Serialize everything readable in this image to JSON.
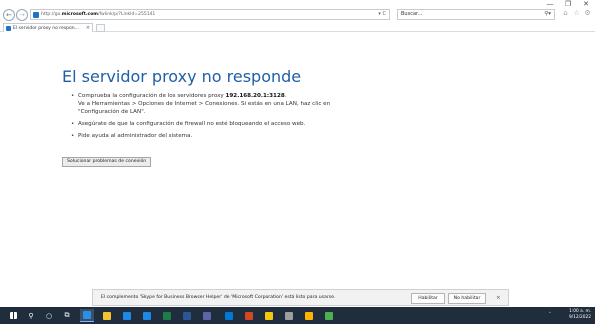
{
  "browser": {
    "url_prefix": "http://go.",
    "url_domain": "microsoft.com",
    "url_suffix": "/fwlink/p/?LinkId=255141",
    "address_tools": "▾ C",
    "search_placeholder": "Buscar...",
    "window_controls": [
      "—",
      "❐",
      "✕"
    ],
    "tab_title": "El servidor proxy no respon...",
    "tab_close": "×"
  },
  "error_page": {
    "heading": "El servidor proxy no responde",
    "bullet1_text": "Comprueba la configuración de los servidores proxy ",
    "bullet1_proxy": "192.168.20.1:3128",
    "bullet1_end": ".",
    "bullet1_line2": "Ve a Herramientas > Opciones de Internet > Conexiones. Si estás en una LAN, haz clic en",
    "bullet1_line3": "\"Configuración de LAN\".",
    "bullet2": "Asegúrate de que la configuración de firewall no esté bloqueando el acceso web.",
    "bullet3": "Pide ayuda al administrador del sistema.",
    "fix_button": "Solucionar problemas de conexión"
  },
  "notification": {
    "message": "El complemento 'Skype for Business Browser Helper' de 'Microsoft Corporation' está listo para usarse.",
    "enable_label": "Habilitar",
    "disable_label": "No habilitar",
    "close": "×"
  },
  "taskbar": {
    "time": "1:00 a. m.",
    "date": "9/12/2022",
    "icons": [
      {
        "name": "start-icon",
        "color": "#ffffff"
      },
      {
        "name": "search-icon",
        "color": "#ffffff"
      },
      {
        "name": "cortana-icon",
        "color": "#ffffff"
      },
      {
        "name": "task-view-icon",
        "color": "#ffffff"
      },
      {
        "name": "ie-icon",
        "color": "#2a8fe6"
      },
      {
        "name": "file-explorer-icon",
        "color": "#f4c430"
      },
      {
        "name": "store-icon",
        "color": "#1e88e5"
      },
      {
        "name": "edge-icon",
        "color": "#1e88e5"
      },
      {
        "name": "excel-icon",
        "color": "#1e7d46"
      },
      {
        "name": "word-icon",
        "color": "#2b5797"
      },
      {
        "name": "teams-icon",
        "color": "#6264a7"
      },
      {
        "name": "outlook-icon",
        "color": "#0078d4"
      },
      {
        "name": "powerpoint-icon",
        "color": "#d24726"
      },
      {
        "name": "notes-icon",
        "color": "#f2c811"
      },
      {
        "name": "settings-icon",
        "color": "#9e9e9e"
      },
      {
        "name": "paint-icon",
        "color": "#ffb300"
      },
      {
        "name": "chrome-icon",
        "color": "#4caf50"
      }
    ]
  },
  "colors": {
    "heading": "#1f5ea8",
    "taskbar": "#1f2d3d"
  }
}
